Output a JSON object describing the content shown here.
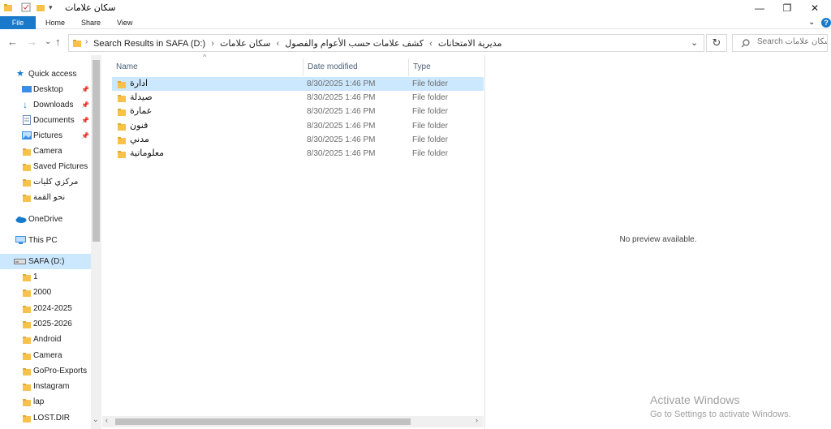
{
  "window": {
    "title": "سكان علامات",
    "qat_dropdown": "▾",
    "minimize": "—",
    "restore": "❐",
    "close": "✕"
  },
  "ribbon": {
    "tabs": [
      "File",
      "Home",
      "Share",
      "View"
    ],
    "expand": "⌄",
    "help": "?"
  },
  "address": {
    "crumbs": [
      "Search Results in SAFA (D:)",
      "مديرية الامتحانات",
      "كشف علامات حسب الأعوام والفصول",
      "سكان علامات"
    ],
    "separator": "›",
    "dropdown": "⌄",
    "refresh": "↻",
    "search_placeholder": "Search سكان علامات"
  },
  "nav": {
    "back": "←",
    "forward": "→",
    "recent": "⌄",
    "up": "↑"
  },
  "sidebar": {
    "quick_access": "Quick access",
    "onedrive": "OneDrive",
    "this_pc": "This PC",
    "drive": "SAFA (D:)",
    "quick_items": [
      {
        "label": "Desktop",
        "pinned": true
      },
      {
        "label": "Downloads",
        "pinned": true
      },
      {
        "label": "Documents",
        "pinned": true
      },
      {
        "label": "Pictures",
        "pinned": true
      },
      {
        "label": "Camera",
        "pinned": false
      },
      {
        "label": "Saved Pictures",
        "pinned": false
      },
      {
        "label": "مركزي كليات",
        "pinned": false
      },
      {
        "label": "نحو القمة",
        "pinned": false
      }
    ],
    "drive_items": [
      "1",
      "2000",
      "2024-2025",
      "2025-2026",
      "Android",
      "Camera",
      "GoPro-Exports",
      "Instagram",
      "lap",
      "LOST.DIR"
    ]
  },
  "columns": {
    "name": "Name",
    "date": "Date modified",
    "type": "Type",
    "sort_indicator": "^"
  },
  "files": [
    {
      "name": "ادارة",
      "date": "8/30/2025 1:46 PM",
      "type": "File folder"
    },
    {
      "name": "صيدلة",
      "date": "8/30/2025 1:46 PM",
      "type": "File folder"
    },
    {
      "name": "عمارة",
      "date": "8/30/2025 1:46 PM",
      "type": "File folder"
    },
    {
      "name": "فنون",
      "date": "8/30/2025 1:46 PM",
      "type": "File folder"
    },
    {
      "name": "مدني",
      "date": "8/30/2025 1:46 PM",
      "type": "File folder"
    },
    {
      "name": "معلوماتية",
      "date": "8/30/2025 1:46 PM",
      "type": "File folder"
    }
  ],
  "preview": {
    "text": "No preview available."
  },
  "watermark": {
    "line1": "Activate Windows",
    "line2": "Go to Settings to activate Windows."
  },
  "colors": {
    "accent": "#1979ca",
    "selection": "#cce8ff",
    "folder": "#f8c24a"
  }
}
